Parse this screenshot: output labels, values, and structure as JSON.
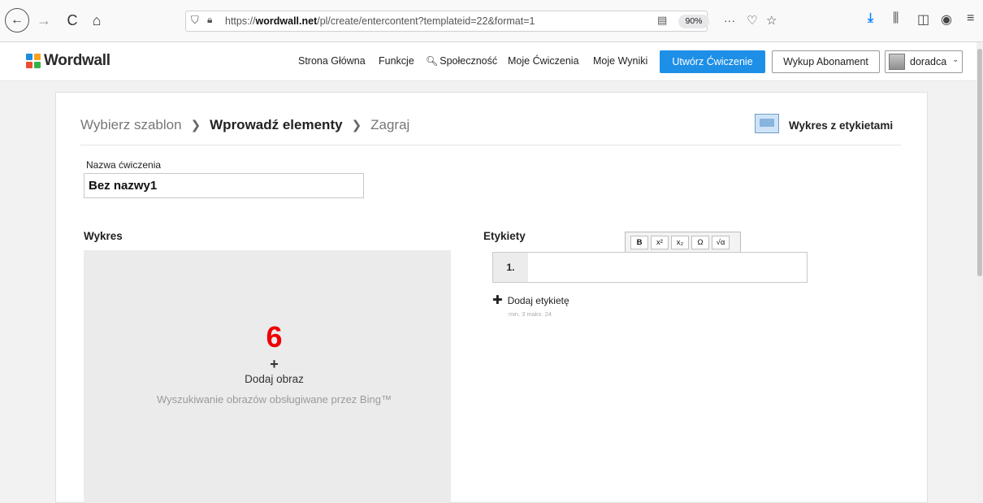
{
  "browser": {
    "back_icon": "←",
    "forward_icon": "→",
    "reload_icon": "C",
    "home_icon": "⌂",
    "url_prefix": "https://",
    "url_domain": "wordwall.net",
    "url_path": "/pl/create/entercontent?templateid=22&format=1",
    "zoom": "90%",
    "more_icon": "···"
  },
  "header": {
    "logo_text": "Wordwall",
    "nav": {
      "home": "Strona Główna",
      "features": "Funkcje",
      "community": "Społeczność",
      "my_exercises": "Moje Ćwiczenia",
      "my_results": "Moje Wyniki"
    },
    "create_button": "Utwórz Ćwiczenie",
    "subscribe_button": "Wykup Abonament",
    "user_name": "doradca",
    "user_chevron": "⌄"
  },
  "breadcrumb": {
    "step1": "Wybierz szablon",
    "sep": "❯",
    "step2": "Wprowadź elementy",
    "step3": "Zagraj"
  },
  "template_name": "Wykres z etykietami",
  "activity": {
    "title_label": "Nazwa ćwiczenia",
    "title_value": "Bez nazwy1"
  },
  "diagram": {
    "heading": "Wykres",
    "annotation": "6",
    "add_plus": "+",
    "add_label": "Dodaj obraz",
    "bing_note": "Wyszukiwanie obrazów obsługiwane przez Bing™"
  },
  "labels": {
    "heading": "Etykiety",
    "toolbar": {
      "bold": "B",
      "superscript": "x²",
      "subscript": "x₂",
      "omega": "Ω",
      "sqrt": "√α"
    },
    "rows": [
      {
        "num": "1.",
        "value": ""
      }
    ],
    "add_icon": "✚",
    "add_label": "Dodaj etykietę",
    "minmax": "min. 3   maks. 24"
  }
}
